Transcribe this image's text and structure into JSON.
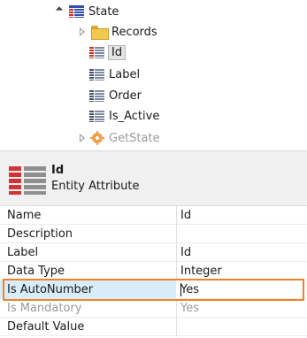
{
  "tree": {
    "entity": {
      "label": "State",
      "icon": "entity-icon"
    },
    "folder": {
      "label": "Records",
      "icon": "folder-icon"
    },
    "attributes": [
      {
        "label": "Id",
        "icon": "id-attribute-icon",
        "selected": true
      },
      {
        "label": "Label",
        "icon": "attribute-icon"
      },
      {
        "label": "Order",
        "icon": "attribute-icon"
      },
      {
        "label": "Is_Active",
        "icon": "attribute-icon"
      }
    ],
    "action": {
      "label": "GetState",
      "icon": "action-icon"
    }
  },
  "header": {
    "title": "Id",
    "subtitle": "Entity Attribute"
  },
  "properties": [
    {
      "name": "Name",
      "value": "Id"
    },
    {
      "name": "Description",
      "value": ""
    },
    {
      "name": "Label",
      "value": "Id"
    },
    {
      "name": "Data Type",
      "value": "Integer"
    },
    {
      "name": "Is AutoNumber",
      "value": "Yes"
    },
    {
      "name": "Is Mandatory",
      "value": "Yes"
    },
    {
      "name": "Default Value",
      "value": ""
    }
  ],
  "colors": {
    "highlight": "#f0812a",
    "selection": "#d8ecfa",
    "header_bg": "#f0f0f0"
  }
}
